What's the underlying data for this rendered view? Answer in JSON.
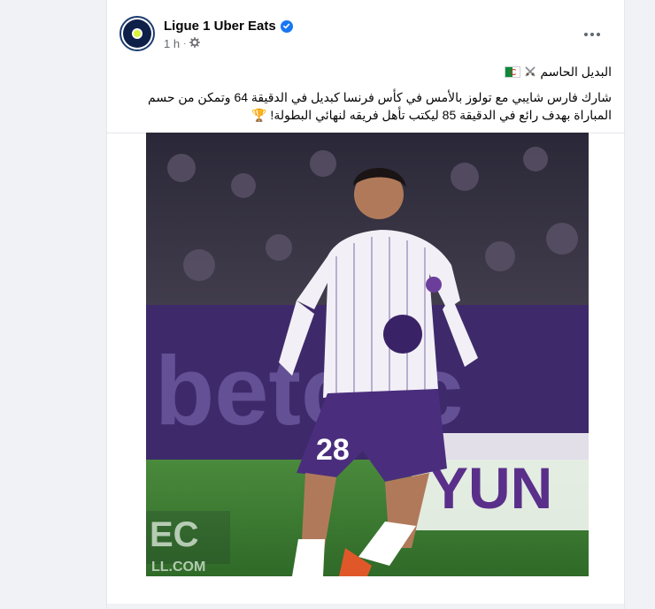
{
  "post": {
    "page_name": "Ligue 1 Uber Eats",
    "time": "1 h",
    "title_line": "البديل الحاسم",
    "body": "شارك فارس شايبي مع تولوز بالأمس في كأس فرنسا كبديل في الدقيقة 64 وتمكن من حسم المباراة بهدف رائع في الدقيقة 85 ليكتب تأهل فريقه لنهائي البطولة! 🏆"
  },
  "photo": {
    "jersey_number": "28",
    "sponsor_text": "betclic",
    "board_text": "YUN",
    "watermark_line1": "EC",
    "watermark_line2": "LL.COM"
  },
  "icons": {
    "verified": "verified-badge-icon",
    "privacy": "gear-icon",
    "more": "more-options-icon",
    "swords": "crossed-swords-icon",
    "flag": "algeria-flag-icon"
  },
  "colors": {
    "accent": "#1877f2",
    "text": "#050505",
    "muted": "#65676b",
    "jersey_purple": "#4a2e7d"
  }
}
